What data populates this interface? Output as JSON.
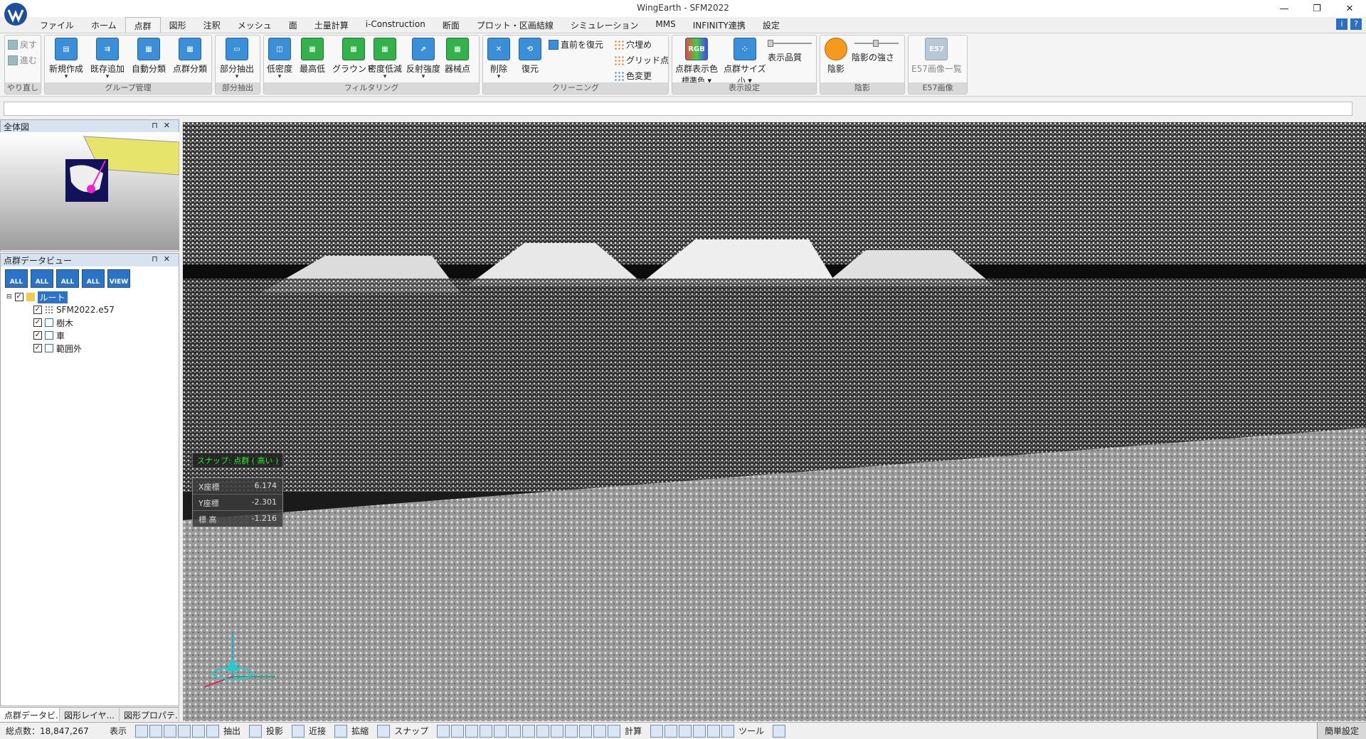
{
  "window": {
    "title": "WingEarth - SFM2022",
    "min": "—",
    "restore": "❐",
    "close": "✕"
  },
  "menu": [
    "ファイル",
    "ホーム",
    "点群",
    "図形",
    "注釈",
    "メッシュ",
    "面",
    "土量計算",
    "i-Construction",
    "断面",
    "プロット・区画結線",
    "シミュレーション",
    "MMS",
    "INFINITY連携",
    "設定"
  ],
  "menu_active": "点群",
  "help": {
    "info": "i",
    "question": "?"
  },
  "ribbon": {
    "undo": {
      "undo": "戻す",
      "redo": "進む",
      "label": "やり直し"
    },
    "group_mgmt": {
      "label": "グループ管理",
      "new": "新規作成",
      "add": "既存追加",
      "auto": "自動分類",
      "pc": "点群分類"
    },
    "partial": {
      "label": "部分抽出",
      "btn": "部分抽出"
    },
    "filter": {
      "label": "フィルタリング",
      "low": "低密度",
      "highlow": "最高低",
      "ground": "グラウンド",
      "reduce": "密度低減",
      "reflect": "反射強度",
      "device": "器械点"
    },
    "cleaning": {
      "label": "クリーニング",
      "delete": "削除",
      "restore": "復元",
      "prev": "直前を復元",
      "fill": "穴埋め",
      "grid": "グリッド点",
      "color": "色変更"
    },
    "display": {
      "label": "表示設定",
      "color_btn": "点群表示色",
      "color_val": "標準色",
      "size_btn": "点群サイズ",
      "size_val": "小",
      "quality": "表示品質"
    },
    "shade": {
      "label": "陰影",
      "btn": "陰影",
      "strength": "陰影の強さ"
    },
    "e57": {
      "label": "E57画像",
      "btn": "E57画像一覧"
    }
  },
  "panels": {
    "overview": "全体図",
    "pcview": "点群データビュー",
    "pin": "⊓",
    "close": "✕",
    "toolbar": [
      "ALL",
      "ALL",
      "ALL",
      "ALL",
      "VIEW"
    ],
    "tree": [
      {
        "label": "ルート",
        "level": 0
      },
      {
        "label": "SFM2022.e57",
        "level": 1
      },
      {
        "label": "樹木",
        "level": 1
      },
      {
        "label": "車",
        "level": 1
      },
      {
        "label": "範囲外",
        "level": 1
      }
    ],
    "tabs": [
      "点群データビ...",
      "図形レイヤ...",
      "図形プロパテ..."
    ]
  },
  "snap": "スナップ: 点群 ( 高い )",
  "readout": {
    "x_label": "X座標",
    "x_value": "6.174",
    "y_label": "Y座標",
    "y_value": "-2.301",
    "z_label": "標 高",
    "z_value": "-1.216"
  },
  "status": {
    "total": "総点数：18,847,267",
    "labels": [
      "表示",
      "抽出",
      "投影",
      "近接",
      "拡縮",
      "スナップ",
      "計算",
      "ツール"
    ],
    "easy": "簡単設定"
  },
  "colors": {
    "accent": "#2a73c6",
    "active_tab": "#ffffff",
    "shade_orange": "#f49a1c"
  }
}
